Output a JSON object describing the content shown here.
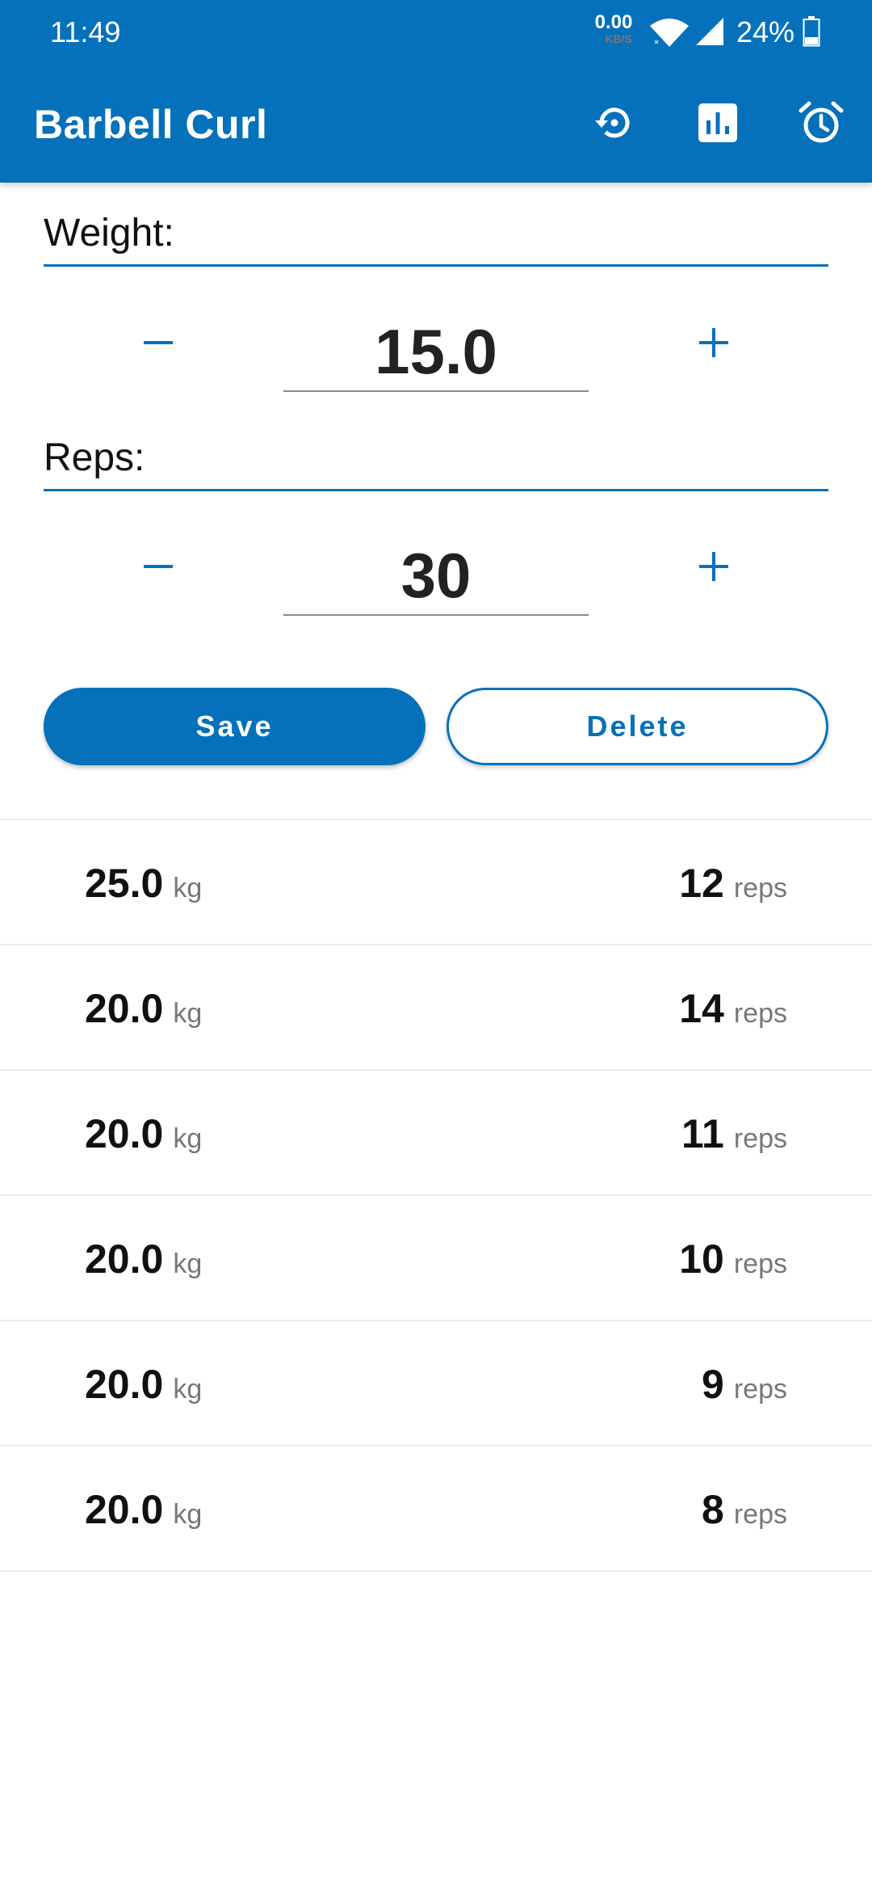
{
  "status_bar": {
    "time": "11:49",
    "net_speed_value": "0.00",
    "net_speed_unit": "KB/S",
    "battery": "24%"
  },
  "toolbar": {
    "title": "Barbell Curl",
    "icons": [
      "history-icon",
      "bar-chart-icon",
      "alarm-icon"
    ]
  },
  "weight": {
    "label": "Weight:",
    "value": "15.0"
  },
  "reps": {
    "label": "Reps:",
    "value": "30"
  },
  "actions": {
    "save_label": "Save",
    "delete_label": "Delete"
  },
  "history": {
    "weight_unit": "kg",
    "reps_unit": "reps",
    "sets": [
      {
        "weight": "25.0",
        "reps": "12"
      },
      {
        "weight": "20.0",
        "reps": "14"
      },
      {
        "weight": "20.0",
        "reps": "11"
      },
      {
        "weight": "20.0",
        "reps": "10"
      },
      {
        "weight": "20.0",
        "reps": "9"
      },
      {
        "weight": "20.0",
        "reps": "8"
      }
    ]
  },
  "colors": {
    "primary": "#0571bb",
    "background": "#ffffff",
    "divider": "#ececec",
    "unit_text": "#777777"
  }
}
